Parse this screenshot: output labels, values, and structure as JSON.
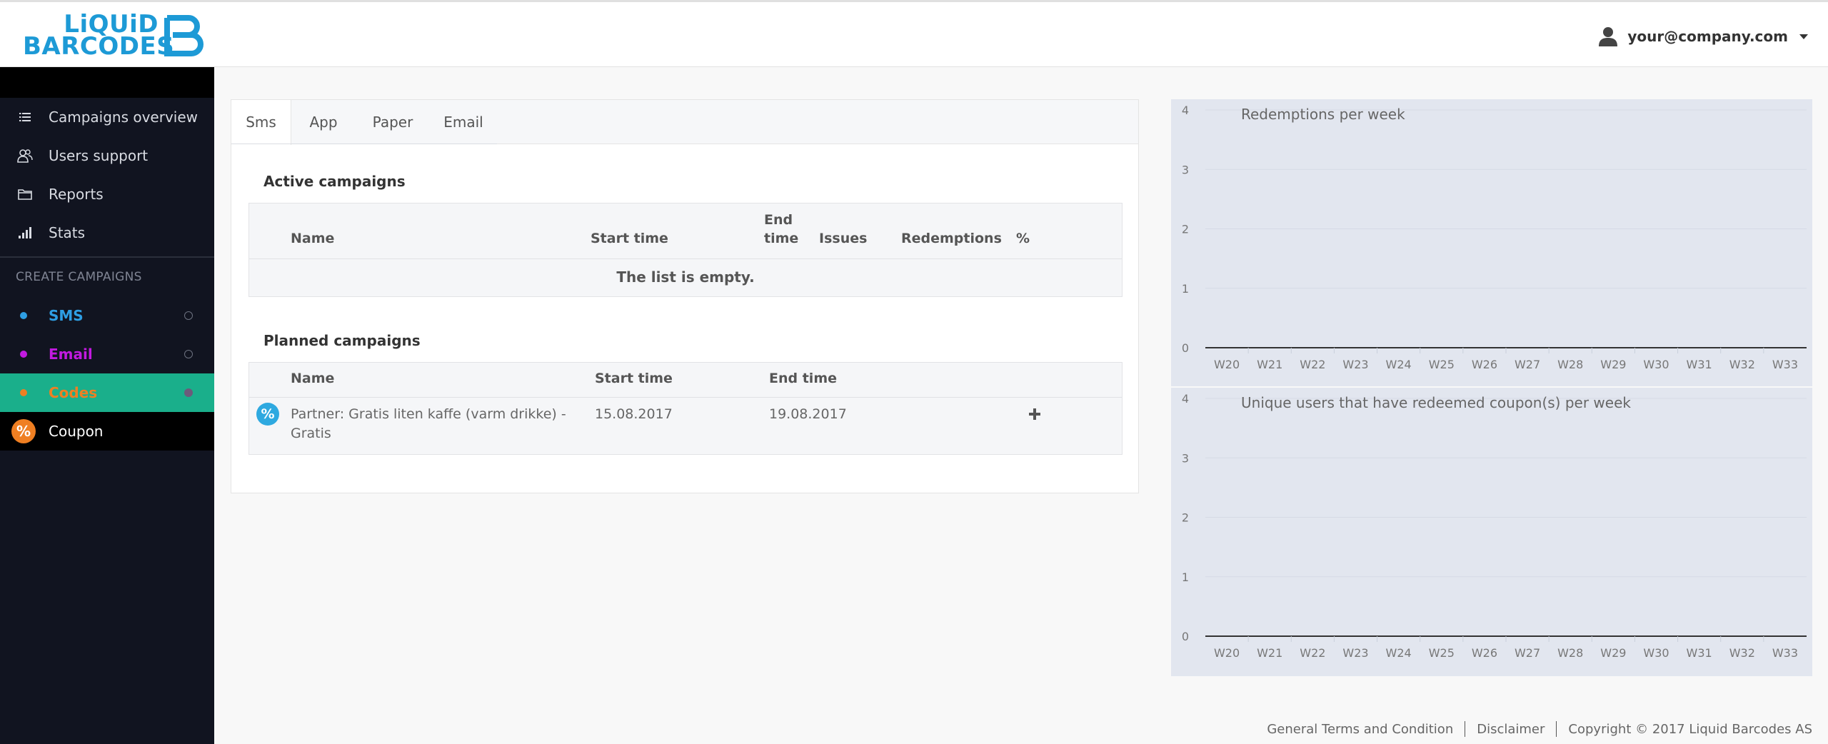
{
  "brand": {
    "line1": "LiQUiD",
    "line2": "BARCODES",
    "color": "#1d9ad6"
  },
  "user": {
    "email": "your@company.com",
    "icon": "user-icon"
  },
  "sidebar": {
    "items": [
      {
        "label": "Campaigns overview",
        "icon": "list-icon"
      },
      {
        "label": "Users support",
        "icon": "users-icon"
      },
      {
        "label": "Reports",
        "icon": "folder-icon"
      },
      {
        "label": "Stats",
        "icon": "signal-icon"
      }
    ],
    "create_title": "CREATE CAMPAIGNS",
    "create_items": [
      {
        "label": "SMS",
        "color": "#2e9ee3"
      },
      {
        "label": "Email",
        "color": "#c21ae0"
      },
      {
        "label": "Codes",
        "color": "#ef7f22"
      }
    ],
    "coupon": {
      "label": "Coupon",
      "badge": "%"
    }
  },
  "tabs": [
    "Sms",
    "App",
    "Paper",
    "Email"
  ],
  "active_campaigns": {
    "title": "Active campaigns",
    "columns": {
      "name": "Name",
      "start": "Start time",
      "end_1": "End",
      "end_2": "time",
      "issues": "Issues",
      "redemptions": "Redemptions",
      "pct": "%"
    },
    "empty_text": "The list is empty."
  },
  "planned_campaigns": {
    "title": "Planned campaigns",
    "columns": {
      "name": "Name",
      "start": "Start time",
      "end": "End time"
    },
    "rows": [
      {
        "badge": "%",
        "name_1": "Partner: Gratis liten kaffe (varm drikke) -",
        "name_2": "Gratis",
        "start": "15.08.2017",
        "end": "19.08.2017"
      }
    ]
  },
  "chart_data": [
    {
      "type": "bar",
      "title": "Redemptions per week",
      "categories": [
        "W20",
        "W21",
        "W22",
        "W23",
        "W24",
        "W25",
        "W26",
        "W27",
        "W28",
        "W29",
        "W30",
        "W31",
        "W32",
        "W33"
      ],
      "values": [
        0,
        0,
        0,
        0,
        0,
        0,
        0,
        0,
        0,
        0,
        0,
        0,
        0,
        0
      ],
      "ylim": [
        0,
        4
      ],
      "yticks": [
        0,
        1,
        2,
        3,
        4
      ],
      "grid": true
    },
    {
      "type": "bar",
      "title": "Unique users that have redeemed coupon(s) per week",
      "categories": [
        "W20",
        "W21",
        "W22",
        "W23",
        "W24",
        "W25",
        "W26",
        "W27",
        "W28",
        "W29",
        "W30",
        "W31",
        "W32",
        "W33"
      ],
      "values": [
        0,
        0,
        0,
        0,
        0,
        0,
        0,
        0,
        0,
        0,
        0,
        0,
        0,
        0
      ],
      "ylim": [
        0,
        4
      ],
      "yticks": [
        0,
        1,
        2,
        3,
        4
      ],
      "grid": true
    }
  ],
  "footer": {
    "terms": "General Terms and Condition",
    "disclaimer": "Disclaimer",
    "copyright": "Copyright © 2017 Liquid Barcodes AS"
  }
}
